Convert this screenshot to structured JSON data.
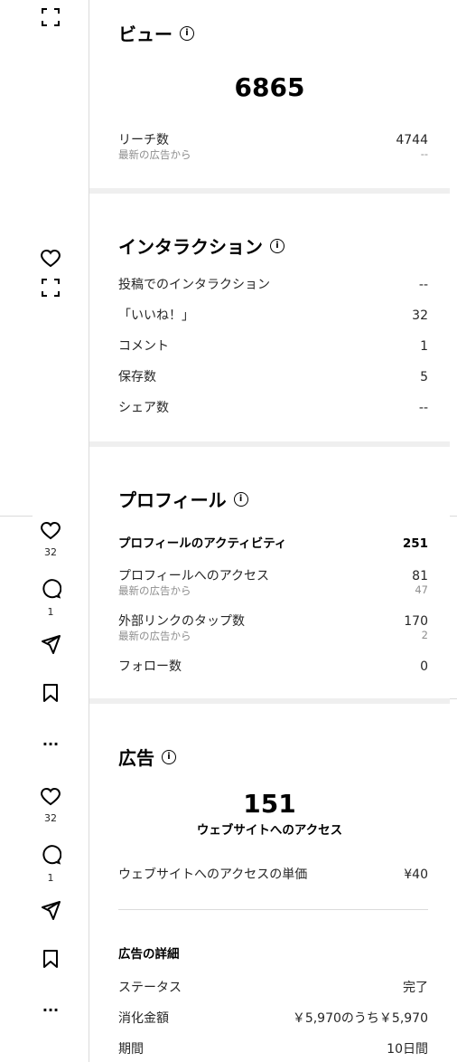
{
  "views": {
    "title": "ビュー",
    "total": "6865",
    "reach_label": "リーチ数",
    "reach_value": "4744",
    "reach_sub_label": "最新の広告から",
    "reach_sub_value": "--"
  },
  "interactions": {
    "title": "インタラクション",
    "rows": [
      {
        "label": "投稿でのインタラクション",
        "value": "--"
      },
      {
        "label": "「いいね！」",
        "value": "32"
      },
      {
        "label": "コメント",
        "value": "1"
      },
      {
        "label": "保存数",
        "value": "5"
      },
      {
        "label": "シェア数",
        "value": "--"
      }
    ]
  },
  "profile": {
    "title": "プロフィール",
    "activity_label": "プロフィールのアクティビティ",
    "activity_value": "251",
    "access_label": "プロフィールへのアクセス",
    "access_value": "81",
    "access_sub_label": "最新の広告から",
    "access_sub_value": "47",
    "link_label": "外部リンクのタップ数",
    "link_value": "170",
    "link_sub_label": "最新の広告から",
    "link_sub_value": "2",
    "follow_label": "フォロー数",
    "follow_value": "0"
  },
  "ads": {
    "title": "広告",
    "total": "151",
    "total_label": "ウェブサイトへのアクセス",
    "unit_label": "ウェブサイトへのアクセスの単価",
    "unit_value": "¥40",
    "details_title": "広告の詳細",
    "status_label": "ステータス",
    "status_value": "完了",
    "spend_label": "消化金額",
    "spend_value": "￥5,970のうち￥5,970",
    "period_label": "期間",
    "period_value": "10日間"
  },
  "left_actions": {
    "post1_likes": "32",
    "post1_comments": "1",
    "post2_likes": "32",
    "post2_comments": "1"
  },
  "icons": {
    "info": "i",
    "more": "..."
  }
}
